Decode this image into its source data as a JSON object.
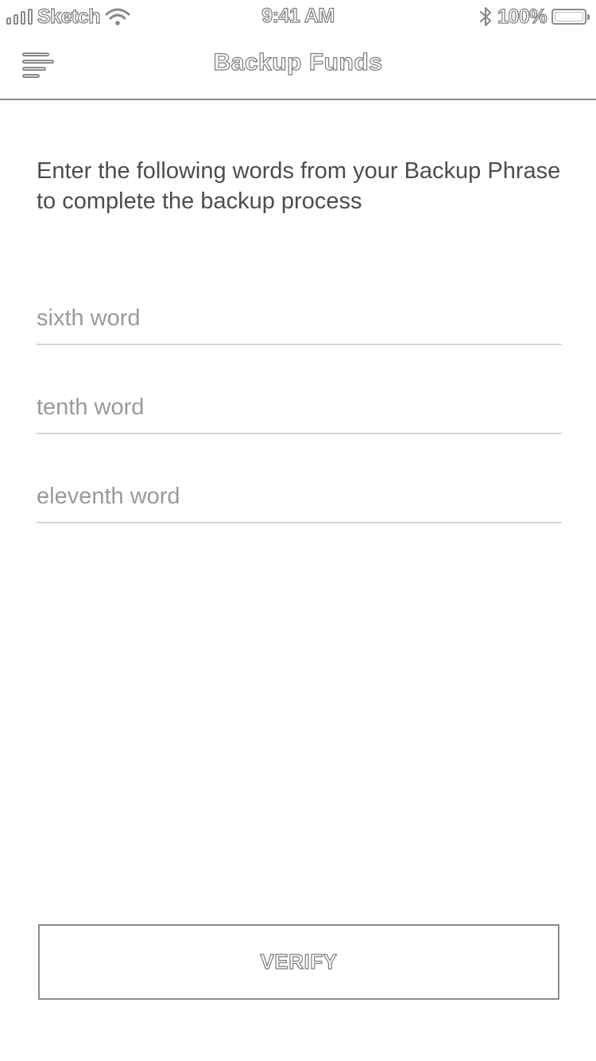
{
  "status_bar": {
    "carrier": "Sketch",
    "time": "9:41 AM",
    "battery_percent": "100%",
    "icons": [
      "signal-icon",
      "wifi-icon",
      "bluetooth-icon",
      "battery-icon"
    ]
  },
  "nav": {
    "title": "Backup Funds",
    "menu_icon": "hamburger-menu-icon"
  },
  "content": {
    "instructions": "Enter the following words from your Backup Phrase to complete the backup process",
    "fields": [
      {
        "placeholder": "sixth word",
        "value": ""
      },
      {
        "placeholder": "tenth word",
        "value": ""
      },
      {
        "placeholder": "eleventh word",
        "value": ""
      }
    ]
  },
  "actions": {
    "verify_label": "VERIFY"
  },
  "colors": {
    "background": "#ffffff",
    "text": "#4d4d4d",
    "placeholder": "#9a9a9a",
    "divider": "#d6d6d6",
    "outline": "#8a8a8a"
  }
}
